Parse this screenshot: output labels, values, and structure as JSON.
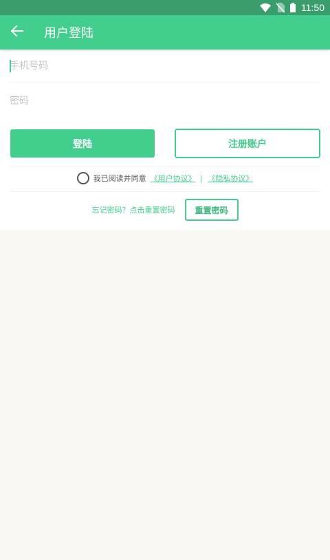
{
  "status_bar": {
    "time": "11:50",
    "icons": [
      "wifi-icon",
      "no-sim-icon",
      "battery-icon"
    ]
  },
  "app_bar": {
    "back_icon": "arrow-left-icon",
    "title": "用户登陆"
  },
  "form": {
    "phone_placeholder": "手机号码",
    "phone_value": "",
    "password_placeholder": "密码",
    "password_value": ""
  },
  "buttons": {
    "login_label": "登陆",
    "register_label": "注册账户"
  },
  "agreement": {
    "checked": false,
    "text": "我已阅读并同意",
    "user_agreement": "《用户协议》",
    "separator": "|",
    "privacy_policy": "《隐私协议》"
  },
  "forgot": {
    "text": "忘记密码？点击重置密码",
    "reset_label": "重置密码"
  },
  "colors": {
    "accent": "#42ce8c",
    "status_bar": "#3a9d6c",
    "background": "#f9f8f3"
  }
}
